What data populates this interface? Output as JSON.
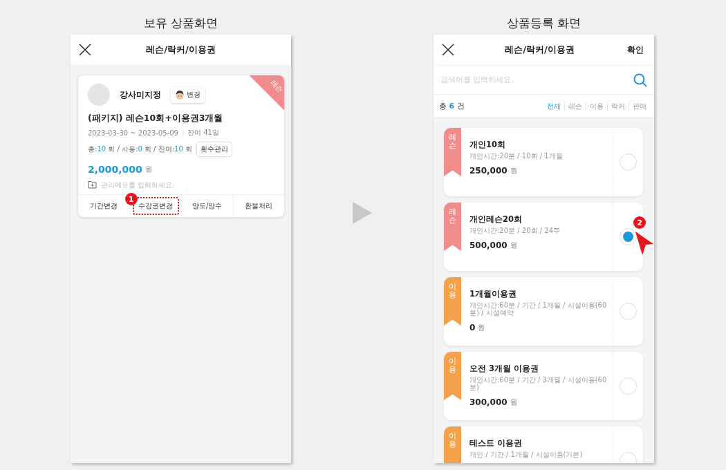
{
  "captions": [
    "보유 상품화면",
    "상품등록 화면"
  ],
  "left_screen": {
    "header": {
      "title": "레슨/락커/이용권"
    },
    "card": {
      "ribbon": "레슨",
      "instructor": "강사미지정",
      "change_button": "변경",
      "title": "(패키지) 레슨10회+이용권3개월",
      "period": "2023-03-30 ~ 2023-05-09",
      "remaining": "잔여 41일",
      "counts": [
        {
          "text": "총:",
          "kind": "plain"
        },
        {
          "text": "10",
          "kind": "number"
        },
        {
          "text": " 회 / 사용:",
          "kind": "plain"
        },
        {
          "text": "0",
          "kind": "number"
        },
        {
          "text": " 회 / 잔여:",
          "kind": "plain"
        },
        {
          "text": "10",
          "kind": "number"
        },
        {
          "text": " 회",
          "kind": "plain"
        }
      ],
      "count_button": "횟수관리",
      "price": "2,000,000",
      "currency": "원",
      "memo_placeholder": "관리메모를 입력하세요.",
      "actions": [
        {
          "label": "기간변경",
          "highlighted": false
        },
        {
          "label": "수강권변경",
          "highlighted": true,
          "marker": "1"
        },
        {
          "label": "양도/양수",
          "highlighted": false
        },
        {
          "label": "환불처리",
          "highlighted": false
        }
      ]
    }
  },
  "right_screen": {
    "header": {
      "title": "레슨/락커/이용권",
      "confirm": "확인"
    },
    "search": {
      "placeholder": "검색어를 입력하세요."
    },
    "total": {
      "prefix": "총",
      "count": "6",
      "suffix": "건"
    },
    "filters": [
      {
        "label": "전체",
        "selected": true
      },
      {
        "label": "레슨",
        "selected": false
      },
      {
        "label": "이용",
        "selected": false
      },
      {
        "label": "락커",
        "selected": false
      },
      {
        "label": "판매",
        "selected": false
      }
    ],
    "products": [
      {
        "tag": "레슨",
        "color": "#f08c8c",
        "name": "개인10회",
        "detail": "개인시간:20분 / 10회 / 1개월",
        "price": "250,000",
        "currency": "원",
        "selected": false
      },
      {
        "tag": "레슨",
        "color": "#f08c8c",
        "name": "개인레슨20회",
        "detail": "개인시간:20분 / 20회 / 24주",
        "price": "500,000",
        "currency": "원",
        "selected": true,
        "marker": "2"
      },
      {
        "tag": "이용",
        "color": "#f5a04a",
        "name": "1개월이용권",
        "detail": "개인시간:60분 / 기간 / 1개월 / 시설이용(60분) / 시설예약",
        "price": "0",
        "currency": "원",
        "selected": false
      },
      {
        "tag": "이용",
        "color": "#f5a04a",
        "name": "오전 3개월 이용권",
        "detail": "개인시간:60분 / 기간 / 3개월 / 시설이용(60분)",
        "price": "300,000",
        "currency": "원",
        "selected": false
      },
      {
        "tag": "이용",
        "color": "#f5a04a",
        "name": "테스트 이용권",
        "detail": "개인 / 기간 / 1개월 / 시설이용(기본)",
        "selected": false
      }
    ]
  }
}
